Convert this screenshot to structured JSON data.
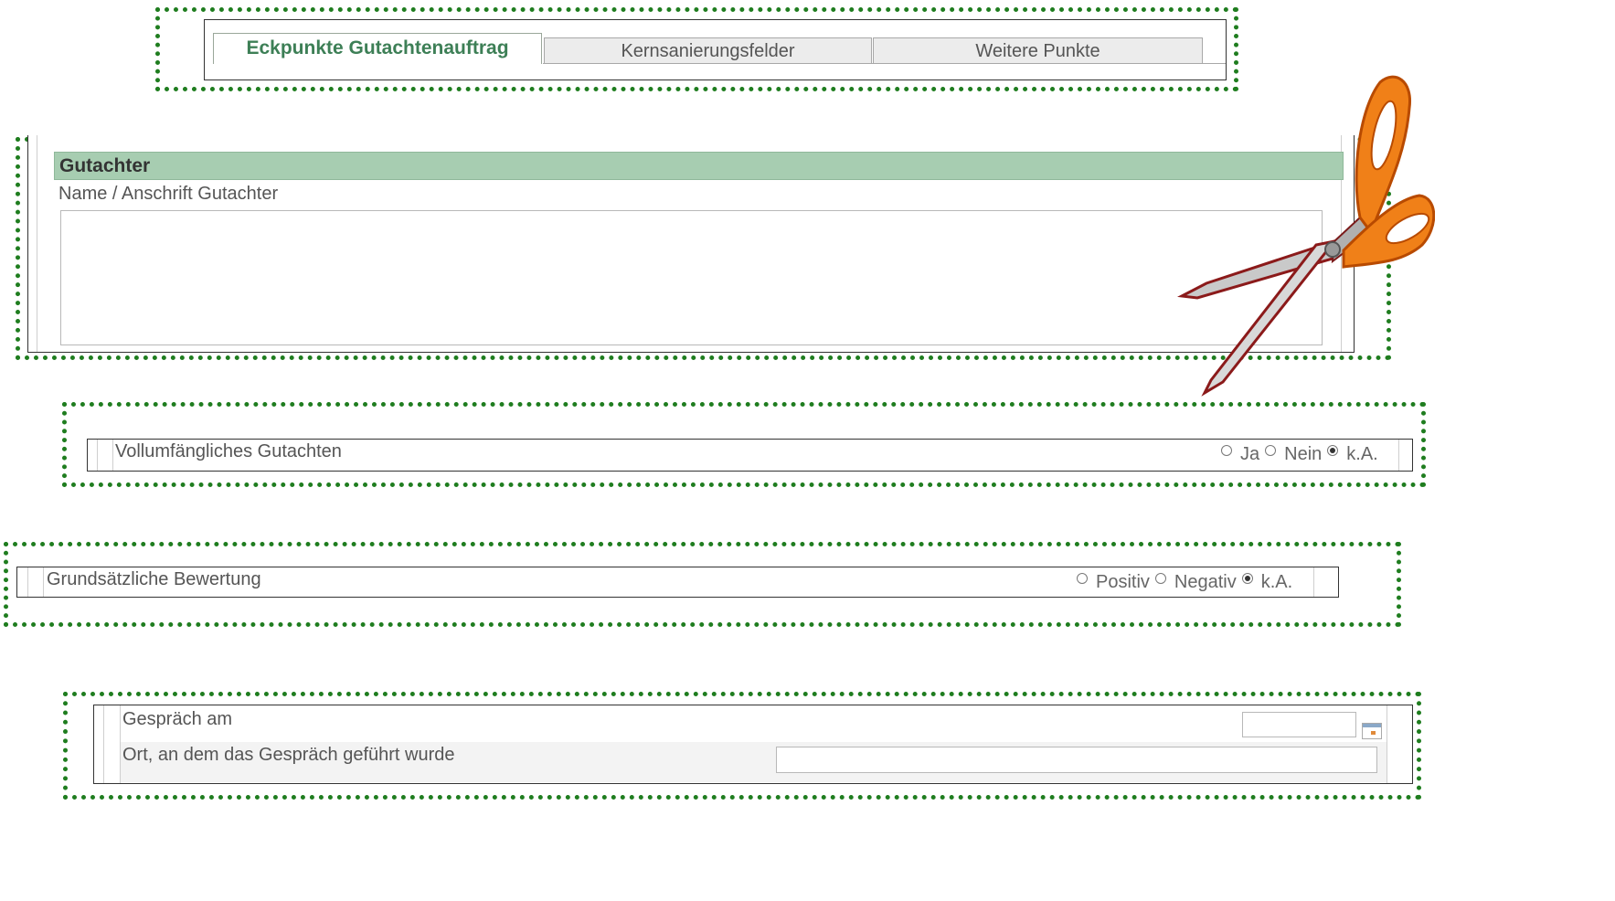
{
  "tabs": {
    "active": "Eckpunkte Gutachtenauftrag",
    "items": [
      "Kernsanierungsfelder",
      "Weitere Punkte"
    ]
  },
  "gutachter": {
    "header": "Gutachter",
    "name_label": "Name / Anschrift Gutachter",
    "name_value": ""
  },
  "vollumfaenglich": {
    "label": "Vollumfängliches Gutachten",
    "options": [
      "Ja",
      "Nein",
      "k.A."
    ],
    "selected": "k.A."
  },
  "bewertung": {
    "label": "Grundsätzliche Bewertung",
    "options": [
      "Positiv",
      "Negativ",
      "k.A."
    ],
    "selected": "k.A."
  },
  "gespraech": {
    "date_label": "Gespräch am",
    "date_value": "",
    "place_label": "Ort, an dem das Gespräch geführt wurde",
    "place_value": ""
  },
  "icons": {
    "scissors": "scissors-icon",
    "calendar": "calendar-icon"
  },
  "colors": {
    "frame": "#1f7d1f",
    "header_bg": "#a7cdb1",
    "active_tab": "#3d7f56"
  }
}
